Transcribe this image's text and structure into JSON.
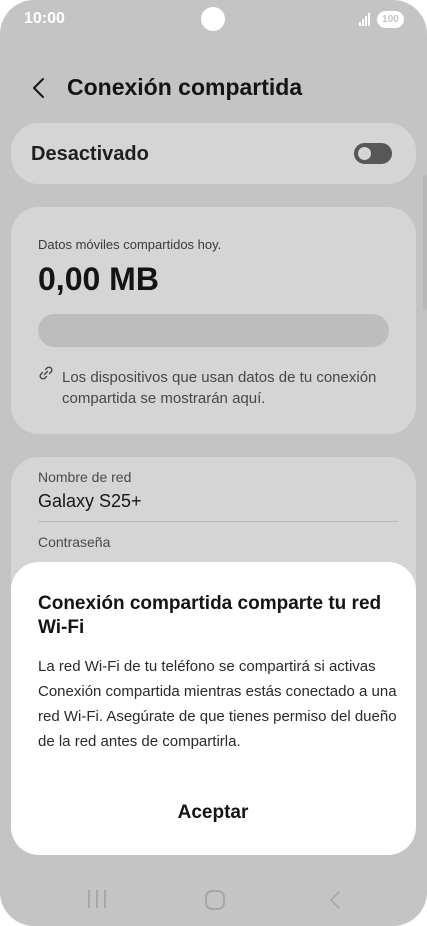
{
  "status_bar": {
    "time": "10:00",
    "battery": "100"
  },
  "header": {
    "title": "Conexión compartida"
  },
  "toggle_card": {
    "label": "Desactivado",
    "enabled": false
  },
  "data_card": {
    "label": "Datos móviles compartidos hoy.",
    "value": "0,00 MB",
    "usage_fraction": 0,
    "info": "Los dispositivos que usan datos de tu conexión compartida se mostrarán aquí."
  },
  "network": {
    "name_label": "Nombre de red",
    "name_value": "Galaxy S25+",
    "password_label": "Contraseña"
  },
  "dialog": {
    "title": "Conexión compartida comparte tu red Wi-Fi",
    "body": "La red Wi-Fi de tu teléfono se compartirá si activas Conexión compartida mientras estás conectado a una red Wi-Fi. Asegúrate de que tienes permiso del dueño de la red antes de compartirla.",
    "accept_label": "Aceptar"
  },
  "icons": {
    "back": "chevron-left-icon",
    "link": "link-icon",
    "nav_recents": "recents-icon",
    "nav_home": "home-icon",
    "nav_back": "back-icon"
  },
  "colors": {
    "scrim_background": "#c4c4c4",
    "card_background": "#d5d5d5",
    "dialog_background": "#ffffff",
    "text_primary": "#141414"
  }
}
